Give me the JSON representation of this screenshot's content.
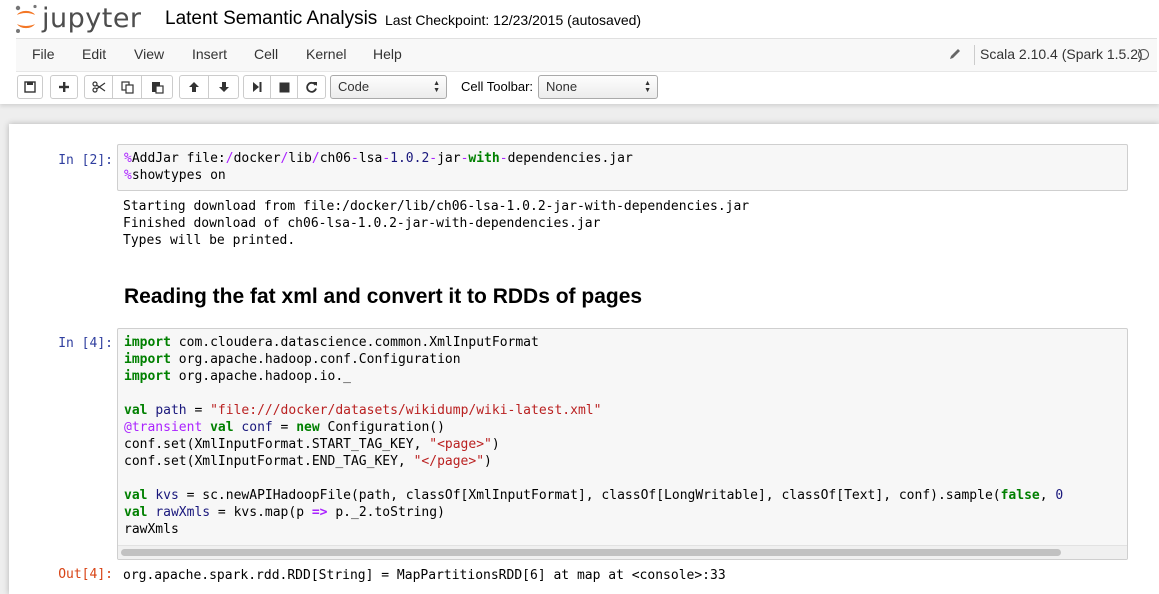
{
  "header": {
    "logo_text": "jupyter",
    "notebook_title": "Latent Semantic Analysis",
    "checkpoint": "Last Checkpoint: 12/23/2015 (autosaved)"
  },
  "menubar": {
    "items": [
      "File",
      "Edit",
      "View",
      "Insert",
      "Cell",
      "Kernel",
      "Help"
    ],
    "kernel": "Scala 2.10.4 (Spark 1.5.2)"
  },
  "toolbar": {
    "cell_type": "Code",
    "cell_toolbar_label": "Cell Toolbar:",
    "cell_toolbar_value": "None"
  },
  "cells": {
    "c1": {
      "prompt": "In [2]:",
      "code": [
        [
          [
            "mag",
            "%"
          ],
          [
            "",
            "AddJar file:"
          ],
          [
            "op",
            "/"
          ],
          [
            "",
            "docker"
          ],
          [
            "op",
            "/"
          ],
          [
            "",
            "lib"
          ],
          [
            "op",
            "/"
          ],
          [
            "",
            "ch06"
          ],
          [
            "op",
            "-"
          ],
          [
            "",
            "lsa"
          ],
          [
            "op",
            "-"
          ],
          [
            "var",
            "1.0.2"
          ],
          [
            "op",
            "-"
          ],
          [
            "",
            "jar"
          ],
          [
            "op",
            "-"
          ],
          [
            "kw",
            "with"
          ],
          [
            "op",
            "-"
          ],
          [
            "",
            "dependencies.jar"
          ]
        ],
        [
          [
            "mag",
            "%"
          ],
          [
            "",
            "showtypes on"
          ]
        ]
      ],
      "output": [
        "Starting download from file:/docker/lib/ch06-lsa-1.0.2-jar-with-dependencies.jar",
        "Finished download of ch06-lsa-1.0.2-jar-with-dependencies.jar",
        "Types will be printed."
      ]
    },
    "markdown": {
      "heading": "Reading the fat xml and convert it to RDDs of pages"
    },
    "c2": {
      "prompt": "In [4]:",
      "code": [
        [
          [
            "kw",
            "import"
          ],
          [
            "",
            " com.cloudera.datascience.common.XmlInputFormat"
          ]
        ],
        [
          [
            "kw",
            "import"
          ],
          [
            "",
            " org.apache.hadoop.conf.Configuration"
          ]
        ],
        [
          [
            "kw",
            "import"
          ],
          [
            "",
            " org.apache.hadoop.io._"
          ]
        ],
        [
          [
            "",
            ""
          ]
        ],
        [
          [
            "kw",
            "val"
          ],
          [
            "",
            " "
          ],
          [
            "var",
            "path"
          ],
          [
            "",
            " = "
          ],
          [
            "str",
            "\"file:///docker/datasets/wikidump/wiki-latest.xml\""
          ]
        ],
        [
          [
            "ann",
            "@transient"
          ],
          [
            "",
            " "
          ],
          [
            "kw",
            "val"
          ],
          [
            "",
            " "
          ],
          [
            "var",
            "conf"
          ],
          [
            "",
            " = "
          ],
          [
            "kw",
            "new"
          ],
          [
            "",
            " Configuration()"
          ]
        ],
        [
          [
            "",
            "conf.set(XmlInputFormat.START_TAG_KEY, "
          ],
          [
            "str",
            "\"<page>\""
          ],
          [
            "",
            ")"
          ]
        ],
        [
          [
            "",
            "conf.set(XmlInputFormat.END_TAG_KEY, "
          ],
          [
            "str",
            "\"</page>\""
          ],
          [
            "",
            ")"
          ]
        ],
        [
          [
            "",
            ""
          ]
        ],
        [
          [
            "kw",
            "val"
          ],
          [
            "",
            " "
          ],
          [
            "var",
            "kvs"
          ],
          [
            "",
            " = sc.newAPIHadoopFile(path, classOf[XmlInputFormat], classOf[LongWritable], classOf[Text], conf).sample("
          ],
          [
            "kw",
            "false"
          ],
          [
            "",
            ", "
          ],
          [
            "var",
            "0"
          ]
        ],
        [
          [
            "kw",
            "val"
          ],
          [
            "",
            " "
          ],
          [
            "var",
            "rawXmls"
          ],
          [
            "",
            " = kvs.map(p "
          ],
          [
            "op-bold",
            "=>"
          ],
          [
            "",
            " p._2.toString)"
          ]
        ],
        [
          [
            "",
            "rawXmls"
          ]
        ]
      ],
      "out_prompt": "Out[4]:",
      "output": "org.apache.spark.rdd.RDD[String] = MapPartitionsRDD[6] at map at <console>:33"
    }
  }
}
